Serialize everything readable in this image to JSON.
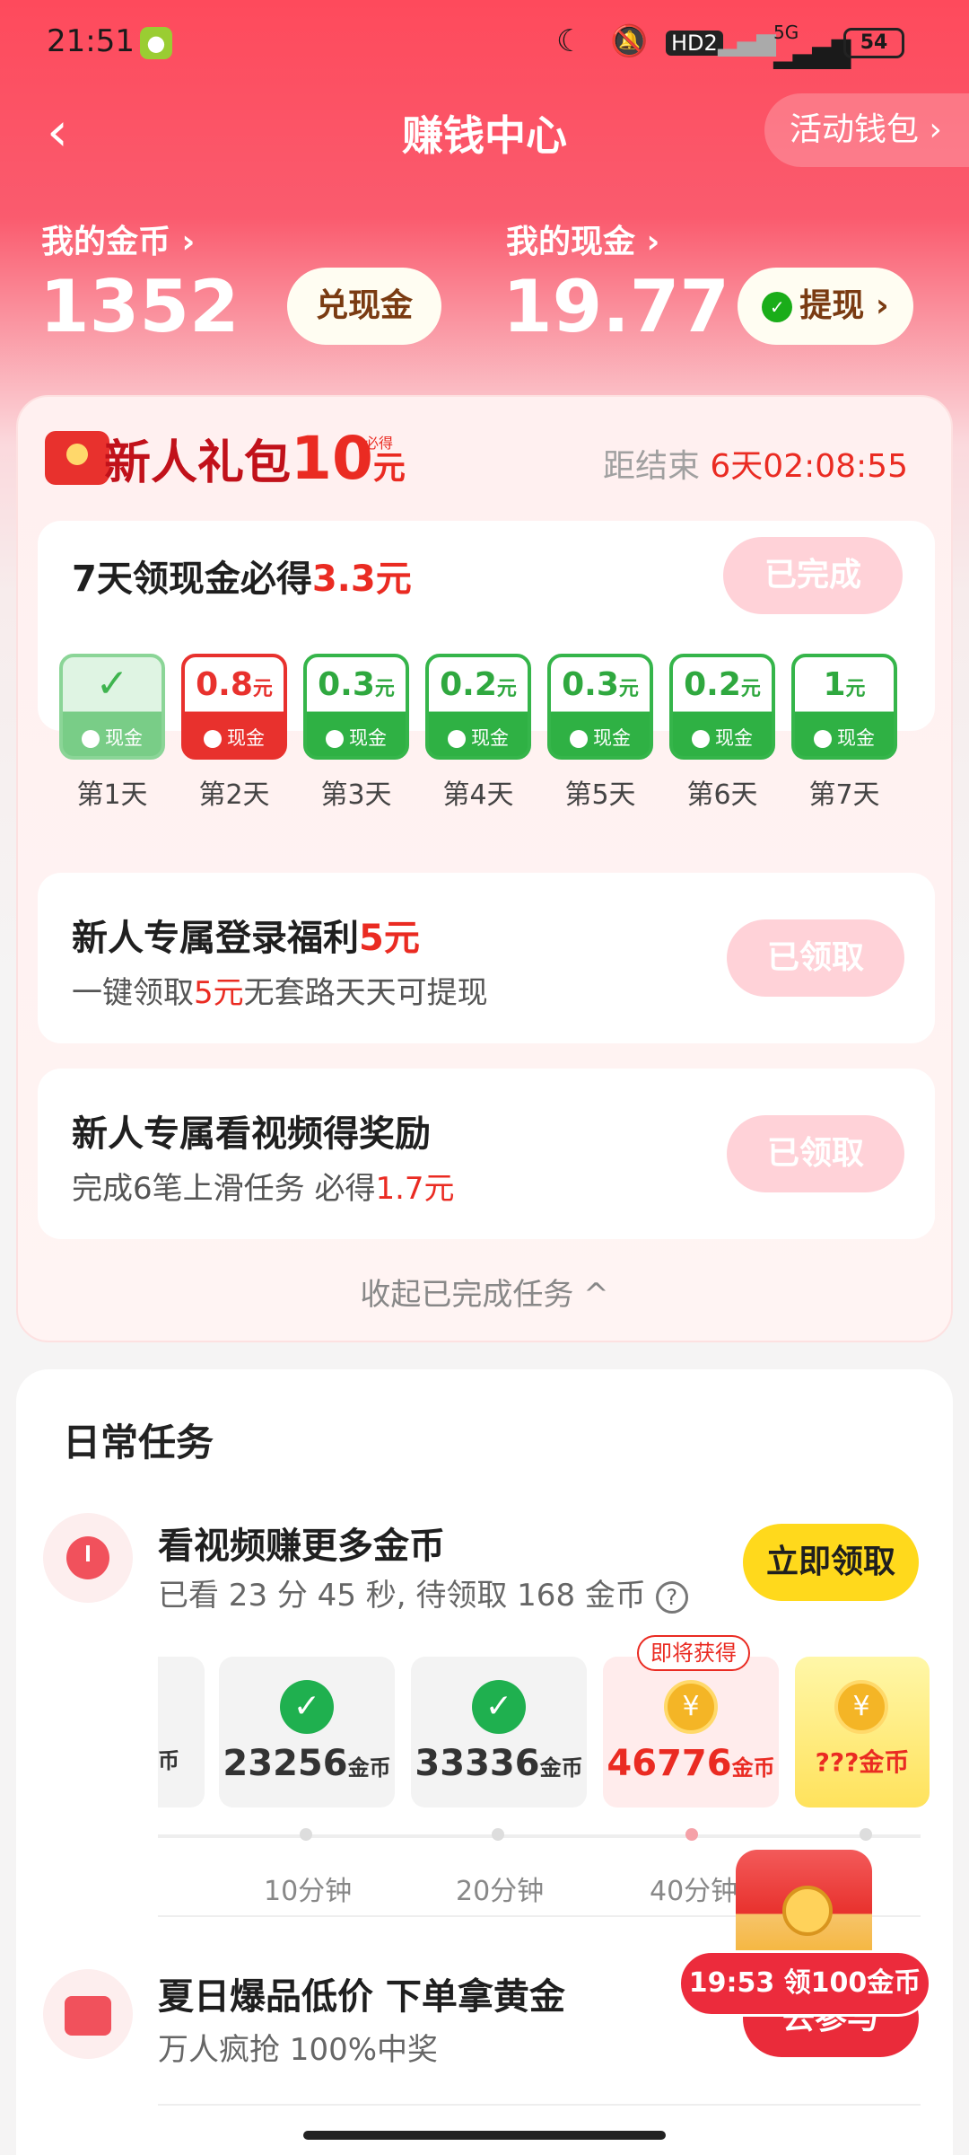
{
  "status_bar": {
    "time": "21:51",
    "network": "5G",
    "hd": "HD2",
    "battery": "54"
  },
  "header": {
    "title": "赚钱中心",
    "wallet_link": "活动钱包"
  },
  "balance": {
    "coins_label": "我的金币 ›",
    "coins_value": "1352",
    "exchange_button": "兑现金",
    "cash_label": "我的现金 ›",
    "cash_value": "19.77",
    "withdraw_button": "提现"
  },
  "newbie": {
    "title_prefix": "新人礼包",
    "amount": "10",
    "unit": "元",
    "must_tag": "必得",
    "countdown_label": "距结束",
    "countdown_value": "6天02:08:55",
    "seven_day": {
      "title": "7天领现金必得",
      "title_amount": "3.3元",
      "status": "已完成",
      "days": [
        {
          "label": "第1天",
          "amount": "",
          "unit": "",
          "state": "done"
        },
        {
          "label": "第2天",
          "amount": "0.8",
          "unit": "元",
          "state": "today"
        },
        {
          "label": "第3天",
          "amount": "0.3",
          "unit": "元",
          "state": "pending"
        },
        {
          "label": "第4天",
          "amount": "0.2",
          "unit": "元",
          "state": "pending"
        },
        {
          "label": "第5天",
          "amount": "0.3",
          "unit": "元",
          "state": "pending"
        },
        {
          "label": "第6天",
          "amount": "0.2",
          "unit": "元",
          "state": "pending"
        },
        {
          "label": "第7天",
          "amount": "1",
          "unit": "元",
          "state": "pending"
        }
      ],
      "cash_tag": "现金"
    },
    "login_bonus": {
      "title": "新人专属登录福利",
      "title_amount": "5元",
      "sub_prefix": "一键领取",
      "sub_amount": "5元",
      "sub_suffix": "无套路天天可提现",
      "status": "已领取"
    },
    "video_bonus": {
      "title": "新人专属看视频得奖励",
      "sub_prefix": "完成6笔上滑任务 必得",
      "sub_amount": "1.7元",
      "status": "已领取"
    },
    "collapse": "收起已完成任务 ^"
  },
  "daily": {
    "title": "日常任务",
    "video_task": {
      "title": "看视频赚更多金币",
      "subtitle": "已看 23 分 45 秒, 待领取 168 金币",
      "button": "立即领取",
      "rewards": [
        {
          "value": "23256",
          "unit": "金币"
        },
        {
          "value": "33336",
          "unit": "金币"
        },
        {
          "value": "46776",
          "unit": "金币",
          "tag": "即将获得"
        },
        {
          "value": "???",
          "unit": "金币"
        }
      ],
      "partial_unit": "币",
      "timeline": [
        "10分钟",
        "20分钟",
        "40分钟"
      ]
    },
    "shop_task": {
      "title": "夏日爆品低价 下单拿黄金",
      "subtitle": "万人疯抢 100%中奖",
      "button": "去参与"
    }
  },
  "floating": {
    "timer_text": "19:53 领100金币"
  }
}
